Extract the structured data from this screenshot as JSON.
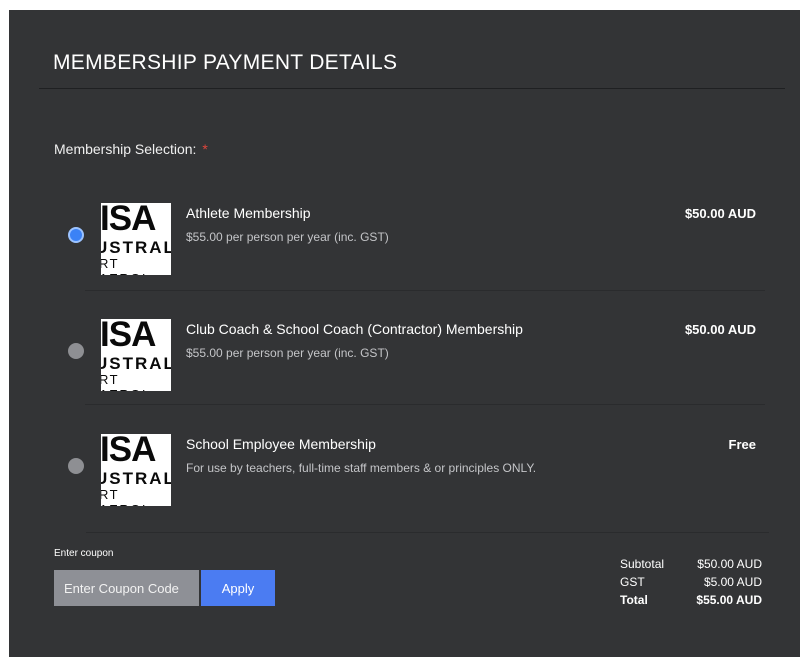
{
  "page": {
    "title": "MEMBERSHIP PAYMENT DETAILS"
  },
  "membership": {
    "label": "Membership Selection:",
    "required_marker": "*",
    "options": [
      {
        "name": "Athlete Membership",
        "description": "$55.00 per person per year (inc. GST)",
        "price": "$50.00 AUD",
        "selected": true,
        "logo_text": [
          "ISA",
          "USTRAL",
          "RT AEROI"
        ]
      },
      {
        "name": "Club Coach & School Coach (Contractor) Membership",
        "description": "$55.00 per person per year (inc. GST)",
        "price": "$50.00 AUD",
        "selected": false,
        "logo_text": [
          "ISA",
          "USTRAL",
          "RT AEROI"
        ]
      },
      {
        "name": "School Employee Membership",
        "description": "For use by teachers, full-time staff members & or principles ONLY.",
        "price": "Free",
        "selected": false,
        "logo_text": [
          "ISA",
          "USTRAL",
          "RT AEROI"
        ]
      }
    ]
  },
  "coupon": {
    "label": "Enter coupon",
    "placeholder": "Enter Coupon Code",
    "value": "",
    "apply_label": "Apply"
  },
  "totals": {
    "subtotal_label": "Subtotal",
    "subtotal_value": "$50.00 AUD",
    "gst_label": "GST",
    "gst_value": "$5.00 AUD",
    "total_label": "Total",
    "total_value": "$55.00 AUD"
  },
  "colors": {
    "panel_bg": "#333436",
    "accent": "#4b7cf2",
    "radio_selected": "#3b82f6",
    "required": "#e0463c"
  }
}
